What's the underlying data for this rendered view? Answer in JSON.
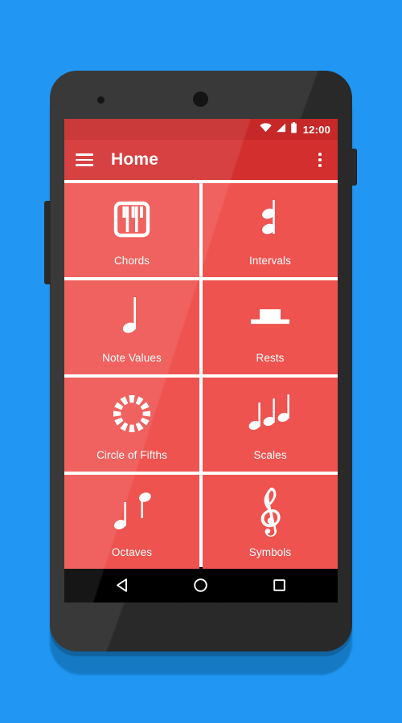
{
  "background": {
    "color": "#2196f3"
  },
  "device": {
    "frame_color": "#2e2e2e",
    "camera_icon": "front-camera-icon",
    "sensor_icon": "proximity-sensor-icon",
    "power_button_label": "Power",
    "volume_button_label": "Volume"
  },
  "status_bar": {
    "background": "#c62828",
    "clock": "12:00",
    "icons": [
      "wifi-icon",
      "cellular-signal-icon",
      "battery-icon"
    ]
  },
  "app_bar": {
    "background": "#d32f2f",
    "title": "Home",
    "menu_icon": "hamburger-menu-icon",
    "overflow_icon": "overflow-menu-icon"
  },
  "grid": {
    "tile_color": "#ef5350",
    "tiles": [
      {
        "label": "Chords",
        "icon": "piano-keys-icon"
      },
      {
        "label": "Intervals",
        "icon": "interval-notes-icon"
      },
      {
        "label": "Note Values",
        "icon": "quarter-note-icon"
      },
      {
        "label": "Rests",
        "icon": "whole-rest-icon"
      },
      {
        "label": "Circle of Fifths",
        "icon": "circle-of-fifths-icon"
      },
      {
        "label": "Scales",
        "icon": "three-notes-icon"
      },
      {
        "label": "Octaves",
        "icon": "octave-notes-icon"
      },
      {
        "label": "Symbols",
        "icon": "treble-clef-icon"
      }
    ]
  },
  "nav_bar": {
    "background": "#000000",
    "back_label": "Back",
    "home_label": "Home",
    "recents_label": "Recents"
  }
}
